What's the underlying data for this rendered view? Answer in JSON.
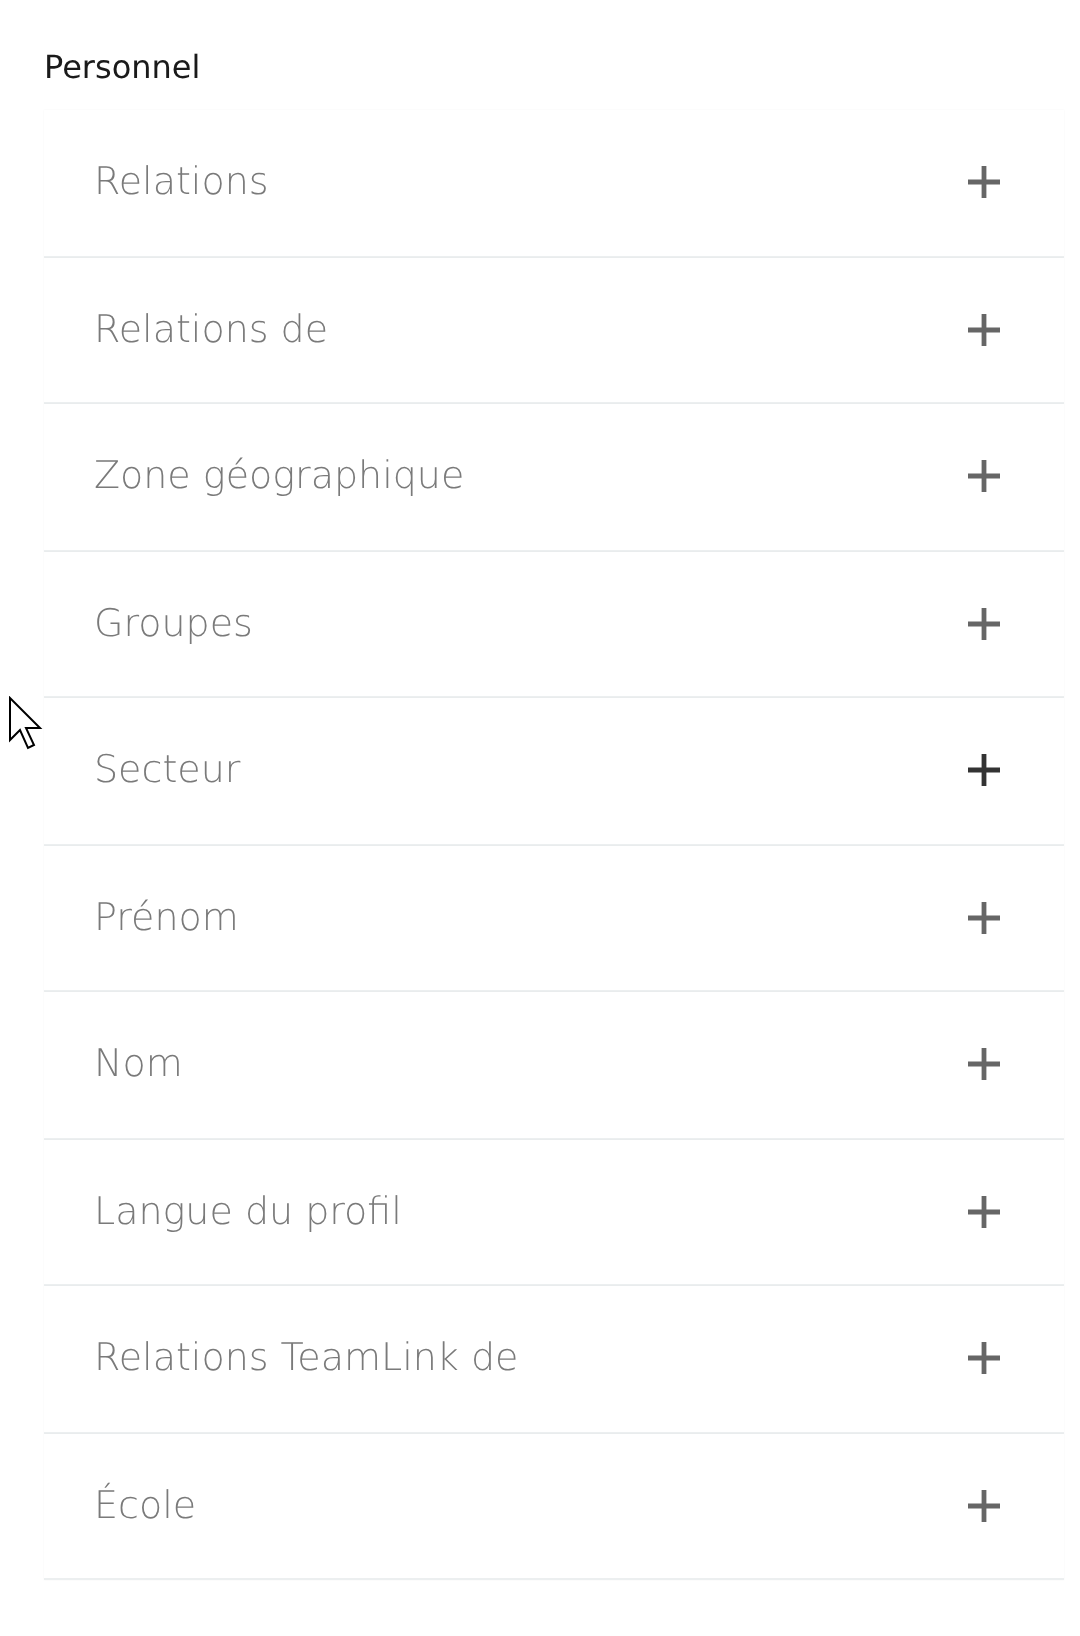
{
  "section": {
    "title": "Personnel"
  },
  "filters": [
    {
      "label": "Relations",
      "hovered": false
    },
    {
      "label": "Relations de",
      "hovered": false
    },
    {
      "label": "Zone géographique",
      "hovered": false
    },
    {
      "label": "Groupes",
      "hovered": false
    },
    {
      "label": "Secteur",
      "hovered": true
    },
    {
      "label": "Prénom",
      "hovered": false
    },
    {
      "label": "Nom",
      "hovered": false
    },
    {
      "label": "Langue du profil",
      "hovered": false
    },
    {
      "label": "Relations TeamLink de",
      "hovered": false
    },
    {
      "label": "École",
      "hovered": false
    }
  ]
}
